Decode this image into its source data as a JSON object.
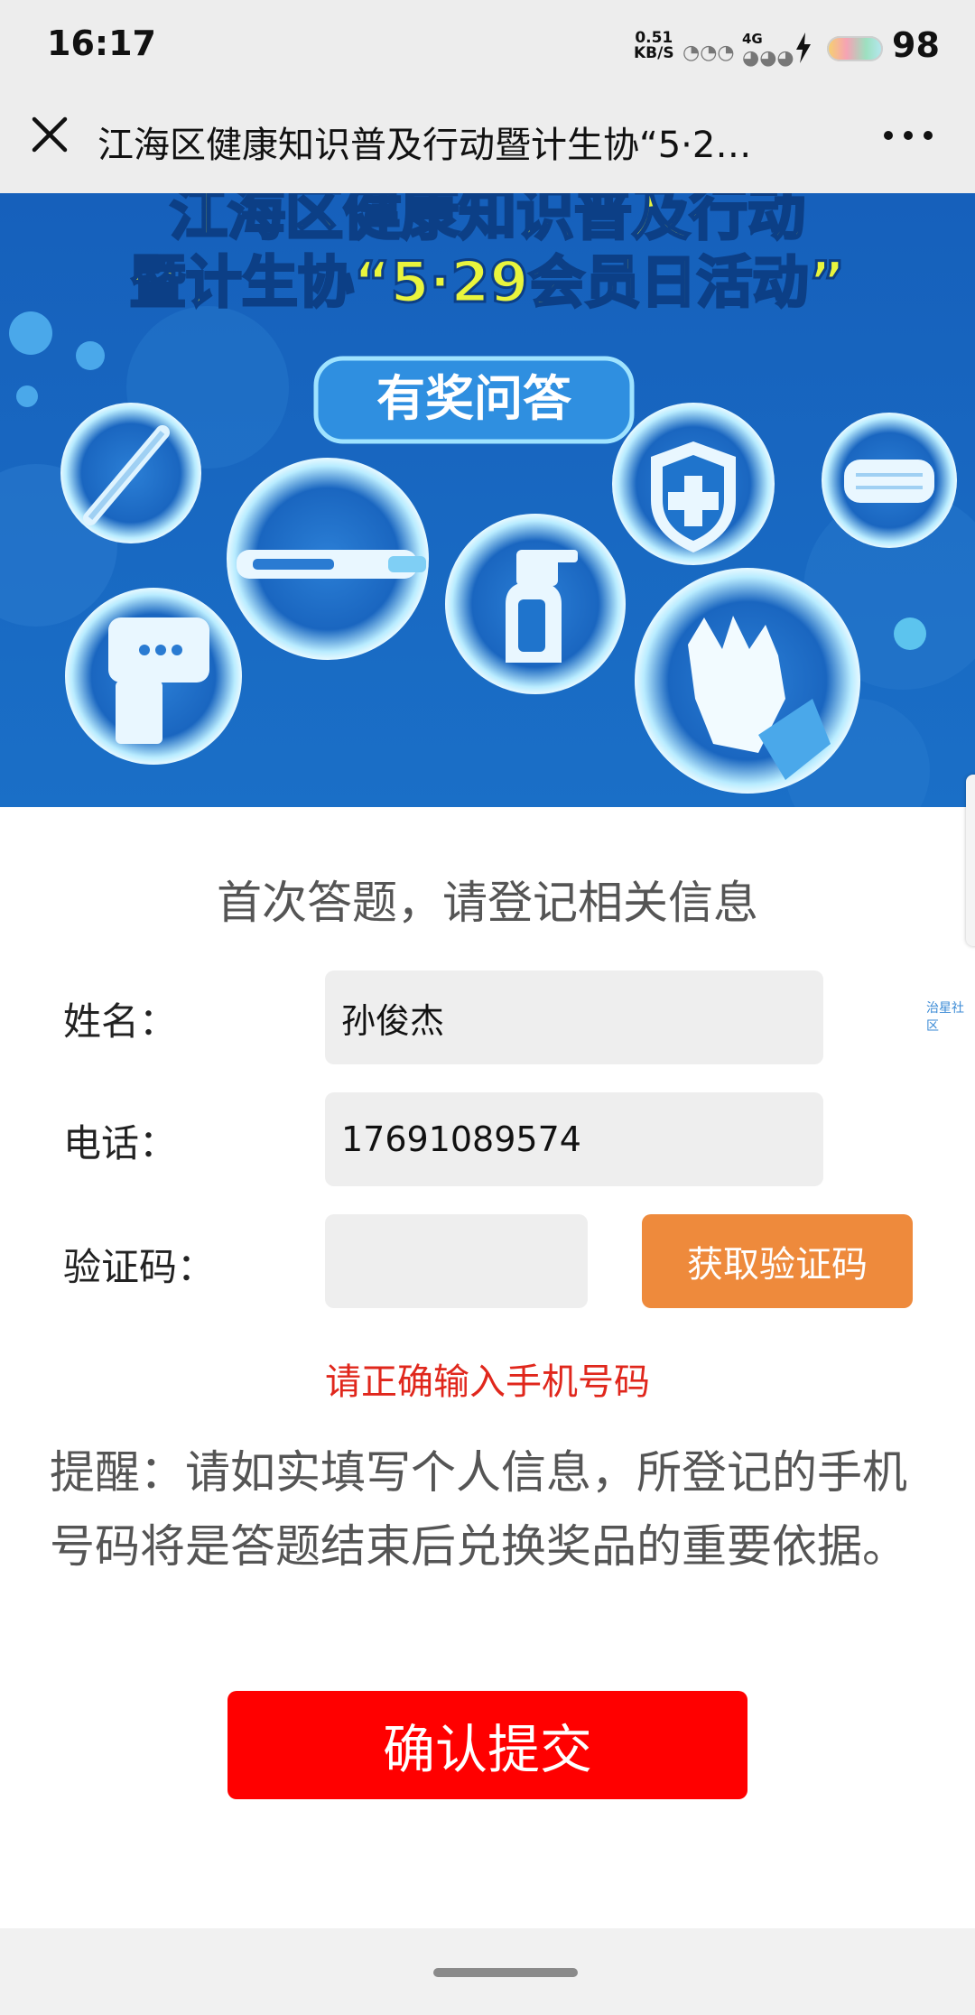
{
  "status_bar": {
    "time": "16:17",
    "net_speed_value": "0.51",
    "net_speed_unit": "KB/S",
    "network_type": "4G",
    "battery_level": "98"
  },
  "title_bar": {
    "title": "江海区健康知识普及行动暨计生协“5·2…",
    "close_icon": "close-icon",
    "more_icon": "more-icon"
  },
  "banner": {
    "title_line1": "江海区健康知识普及行动",
    "title_line2": "暨计生协“5·29会员日活动”",
    "badge": "有奖问答",
    "colors": {
      "background": "#1667c0",
      "title": "#e9f53d",
      "badge": "#2f8fe0"
    }
  },
  "side_label": "治星社区",
  "form": {
    "heading": "首次答题，请登记相关信息",
    "name_label": "姓名：",
    "name_value": "孙俊杰",
    "phone_label": "电话：",
    "phone_value": "17691089574",
    "code_label": "验证码：",
    "code_value": "",
    "get_code_button": "获取验证码",
    "error_message": "请正确输入手机号码",
    "reminder": "提醒：请如实填写个人信息，所登记的手机号码将是答题结束后兑换奖品的重要依据。",
    "submit_button": "确认提交"
  },
  "colors": {
    "accent_orange": "#ee8a3c",
    "submit_red": "#ff0000",
    "error_red": "#e0271c"
  }
}
